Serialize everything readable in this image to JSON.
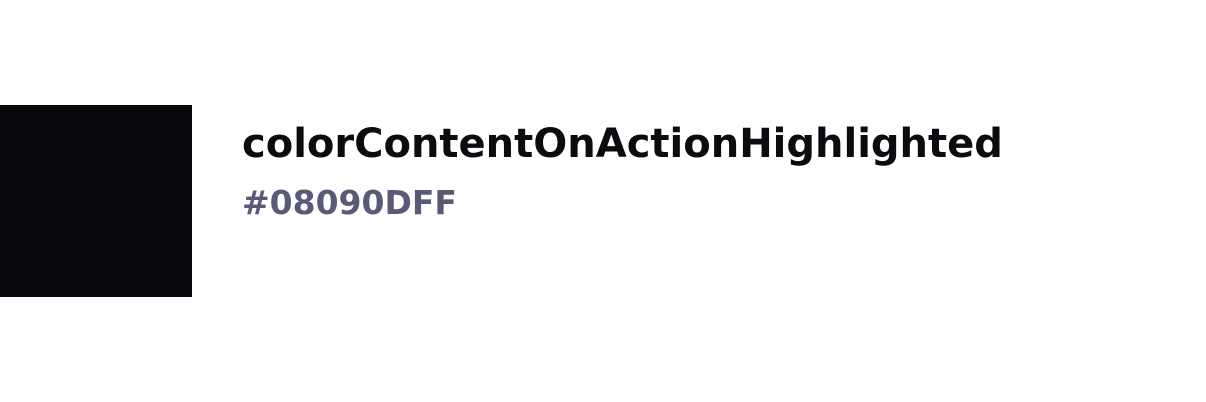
{
  "token": {
    "name": "colorContentOnActionHighlighted",
    "value": "#08090DFF",
    "swatch_color": "#08090D"
  },
  "colors": {
    "name_text": "#0b0c10",
    "value_text": "#5a5a78",
    "background": "#ffffff"
  }
}
